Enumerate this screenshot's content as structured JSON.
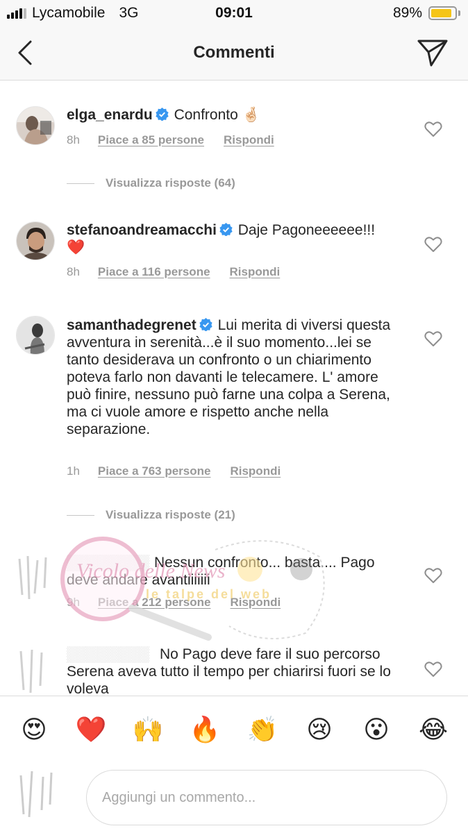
{
  "status_bar": {
    "carrier": "Lycamobile",
    "network": "3G",
    "time": "09:01",
    "battery": "89%",
    "battery_level": 0.89,
    "battery_color": "#f5c518"
  },
  "nav": {
    "title": "Commenti",
    "back_icon": "chevron-left-icon",
    "send_icon": "paper-plane-icon"
  },
  "comments": [
    {
      "username": "elga_enardu",
      "verified": true,
      "text": "Confronto 🤞🏻",
      "text_after": "",
      "age": "8h",
      "likes": "Piace a 85 persone",
      "reply": "Rispondi",
      "view_replies": "Visualizza risposte (64)"
    },
    {
      "username": "stefanoandreamacchi",
      "verified": true,
      "text": "Daje Pagoneeeeee!!!",
      "text_after": "❤️",
      "age": "8h",
      "likes": "Piace a 116 persone",
      "reply": "Rispondi"
    },
    {
      "username": "samanthadegrenet",
      "verified": true,
      "text": "Lui merita di viversi questa avventura in serenità...è  il suo momento...lei se tanto desiderava un confronto o un chiarimento poteva farlo non davanti le telecamere. L' amore può  finire, nessuno può farne una colpa a Serena, ma ci vuole amore e rispetto anche nella separazione.",
      "age": "1h",
      "likes": "Piace a 763 persone",
      "reply": "Rispondi",
      "view_replies": "Visualizza risposte (21)"
    },
    {
      "username": "",
      "text": "Nessun confronto... basta.... Pago deve andare avantiiiiiii",
      "age": "9h",
      "likes": "Piace a 212 persone",
      "reply": "Rispondi"
    },
    {
      "username": "",
      "text": "No Pago deve fare il suo percorso Serena aveva tutto il tempo per chiarirsi fuori se lo voleva"
    }
  ],
  "watermark": {
    "text1": "Vicolo delle News",
    "text2": "le talpe del web"
  },
  "emoji_bar": [
    "😍",
    "❤️",
    "🙌",
    "🔥",
    "👏",
    "😢",
    "😮",
    "😂"
  ],
  "input": {
    "placeholder": "Aggiungi un commento..."
  }
}
